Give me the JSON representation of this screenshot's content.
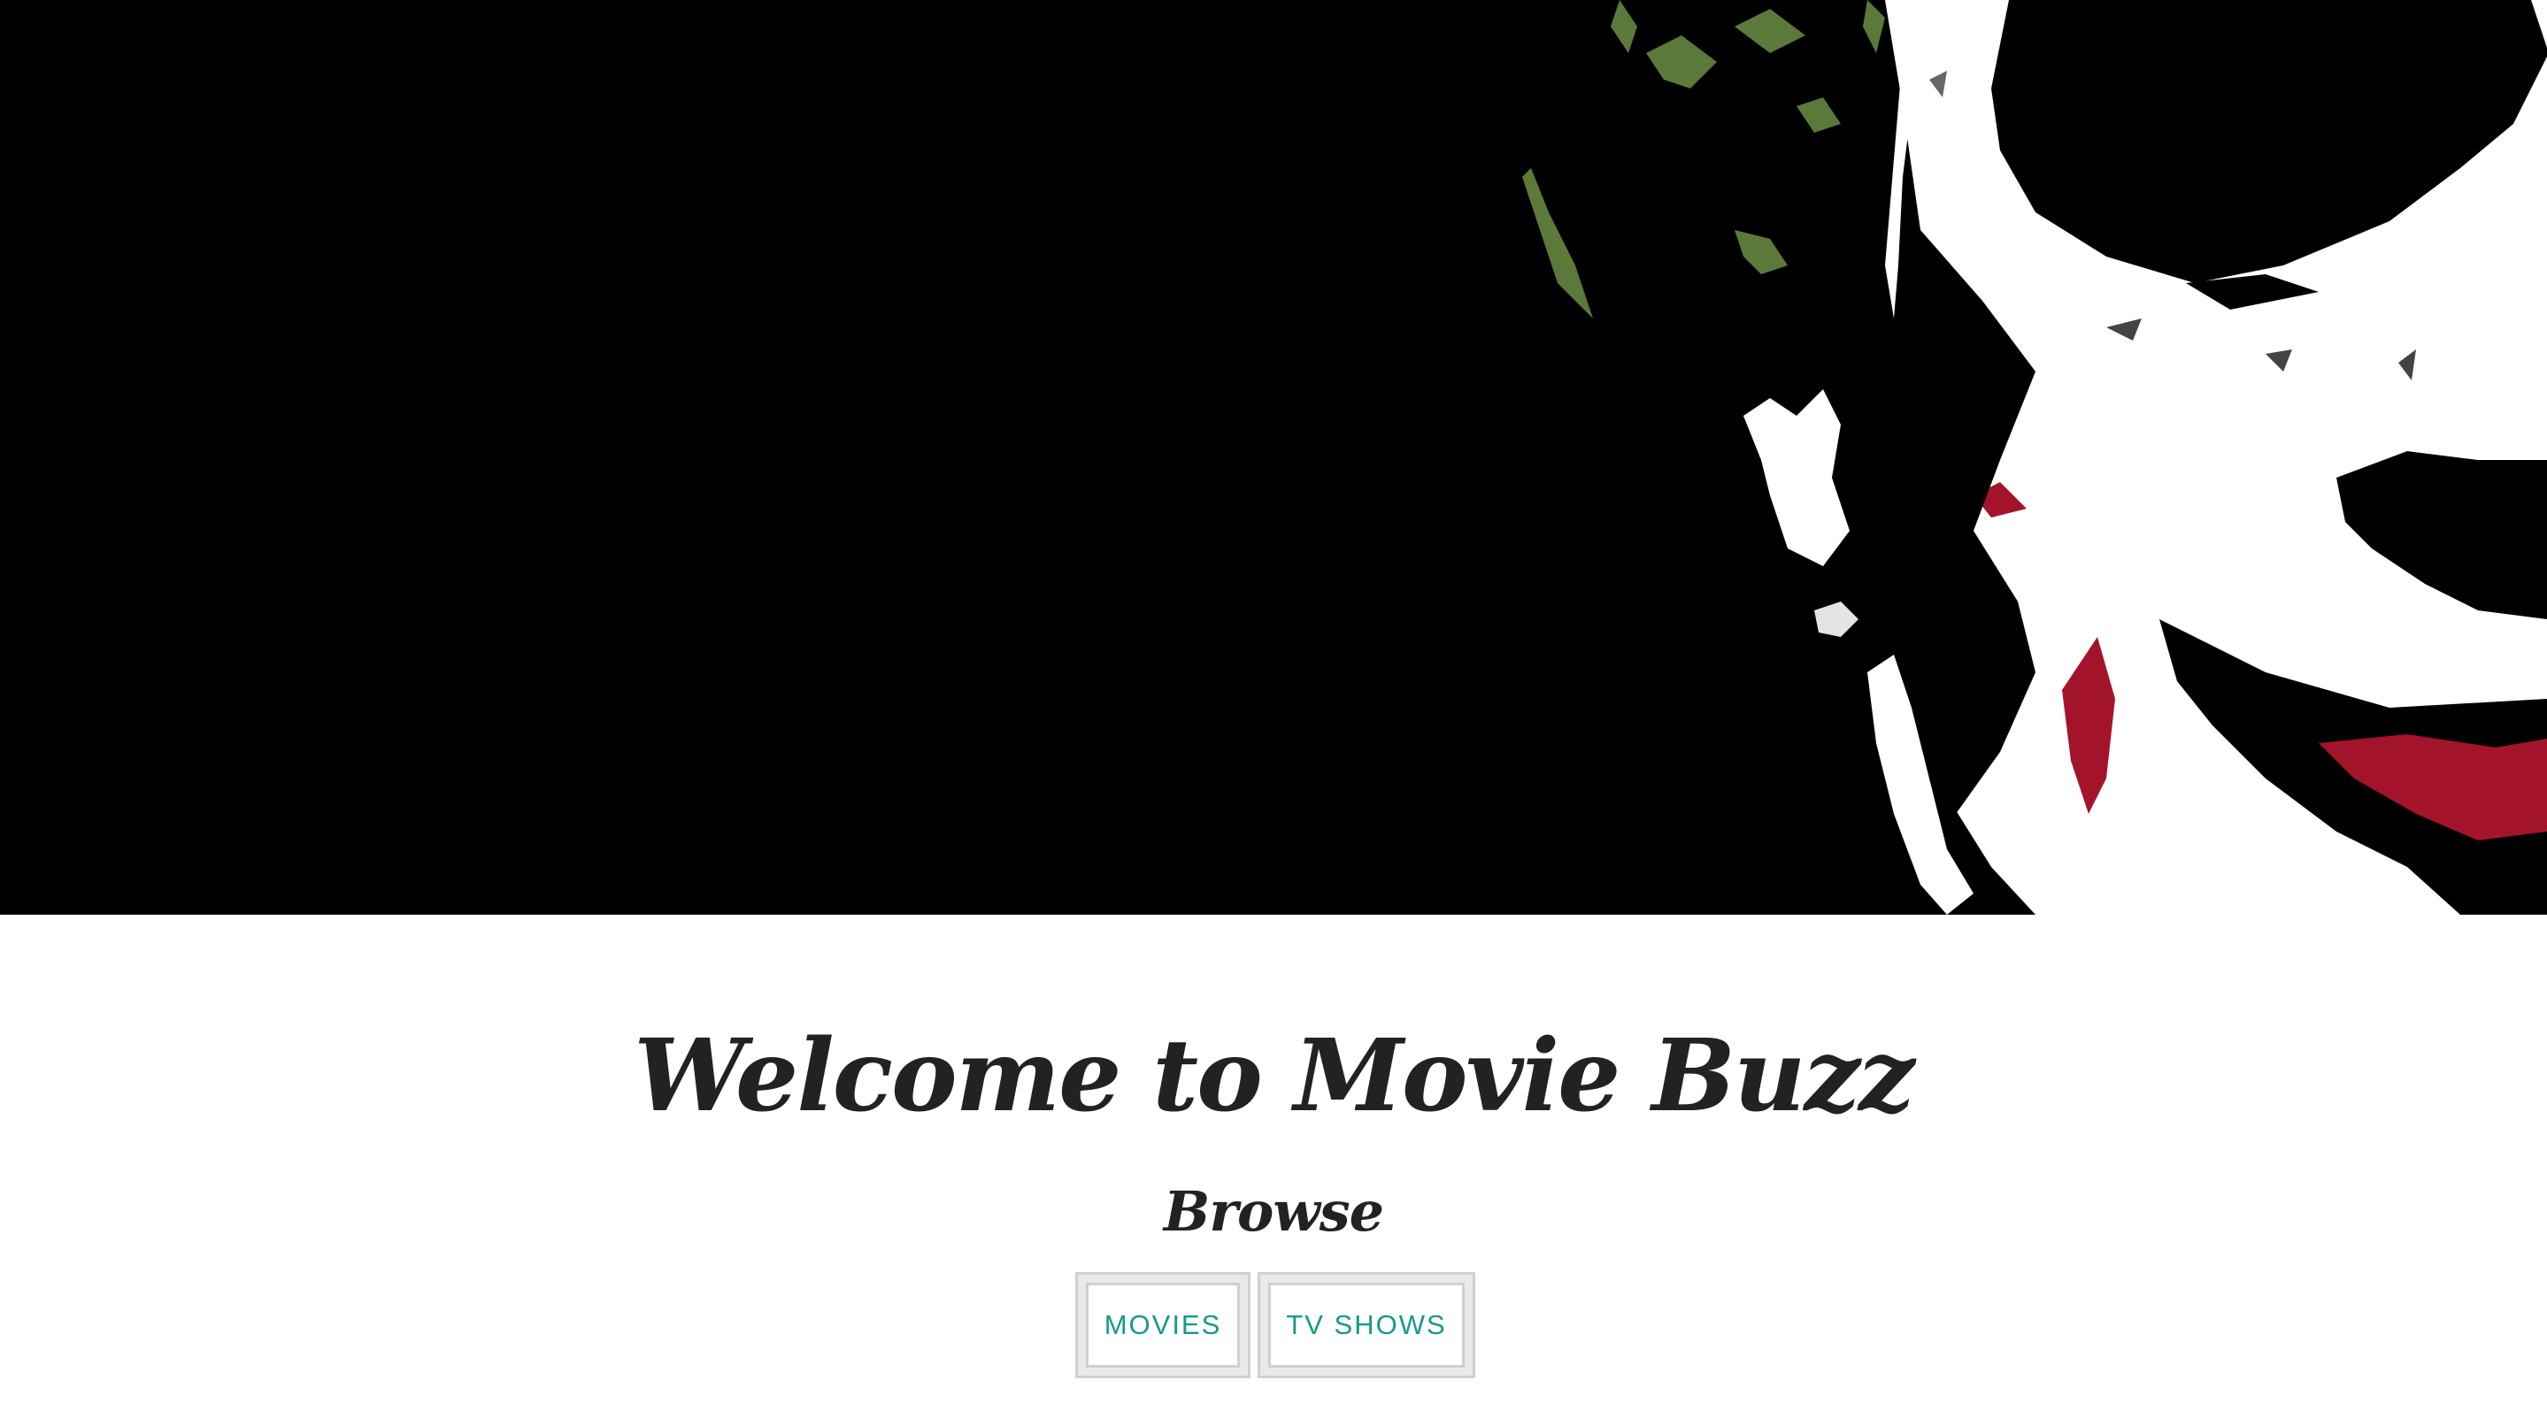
{
  "hero": {
    "image_icon": "joker-face-illustration",
    "colors": {
      "background": "#000000",
      "face": "#ffffff",
      "hair": "#5b7a3a",
      "lips": "#a3142a"
    }
  },
  "main": {
    "title": "Welcome to Movie Buzz",
    "subtitle": "Browse",
    "buttons": [
      {
        "label": "MOVIES"
      },
      {
        "label": "TV SHOWS"
      }
    ],
    "accent_color": "#16998a",
    "text_color": "#222222"
  }
}
